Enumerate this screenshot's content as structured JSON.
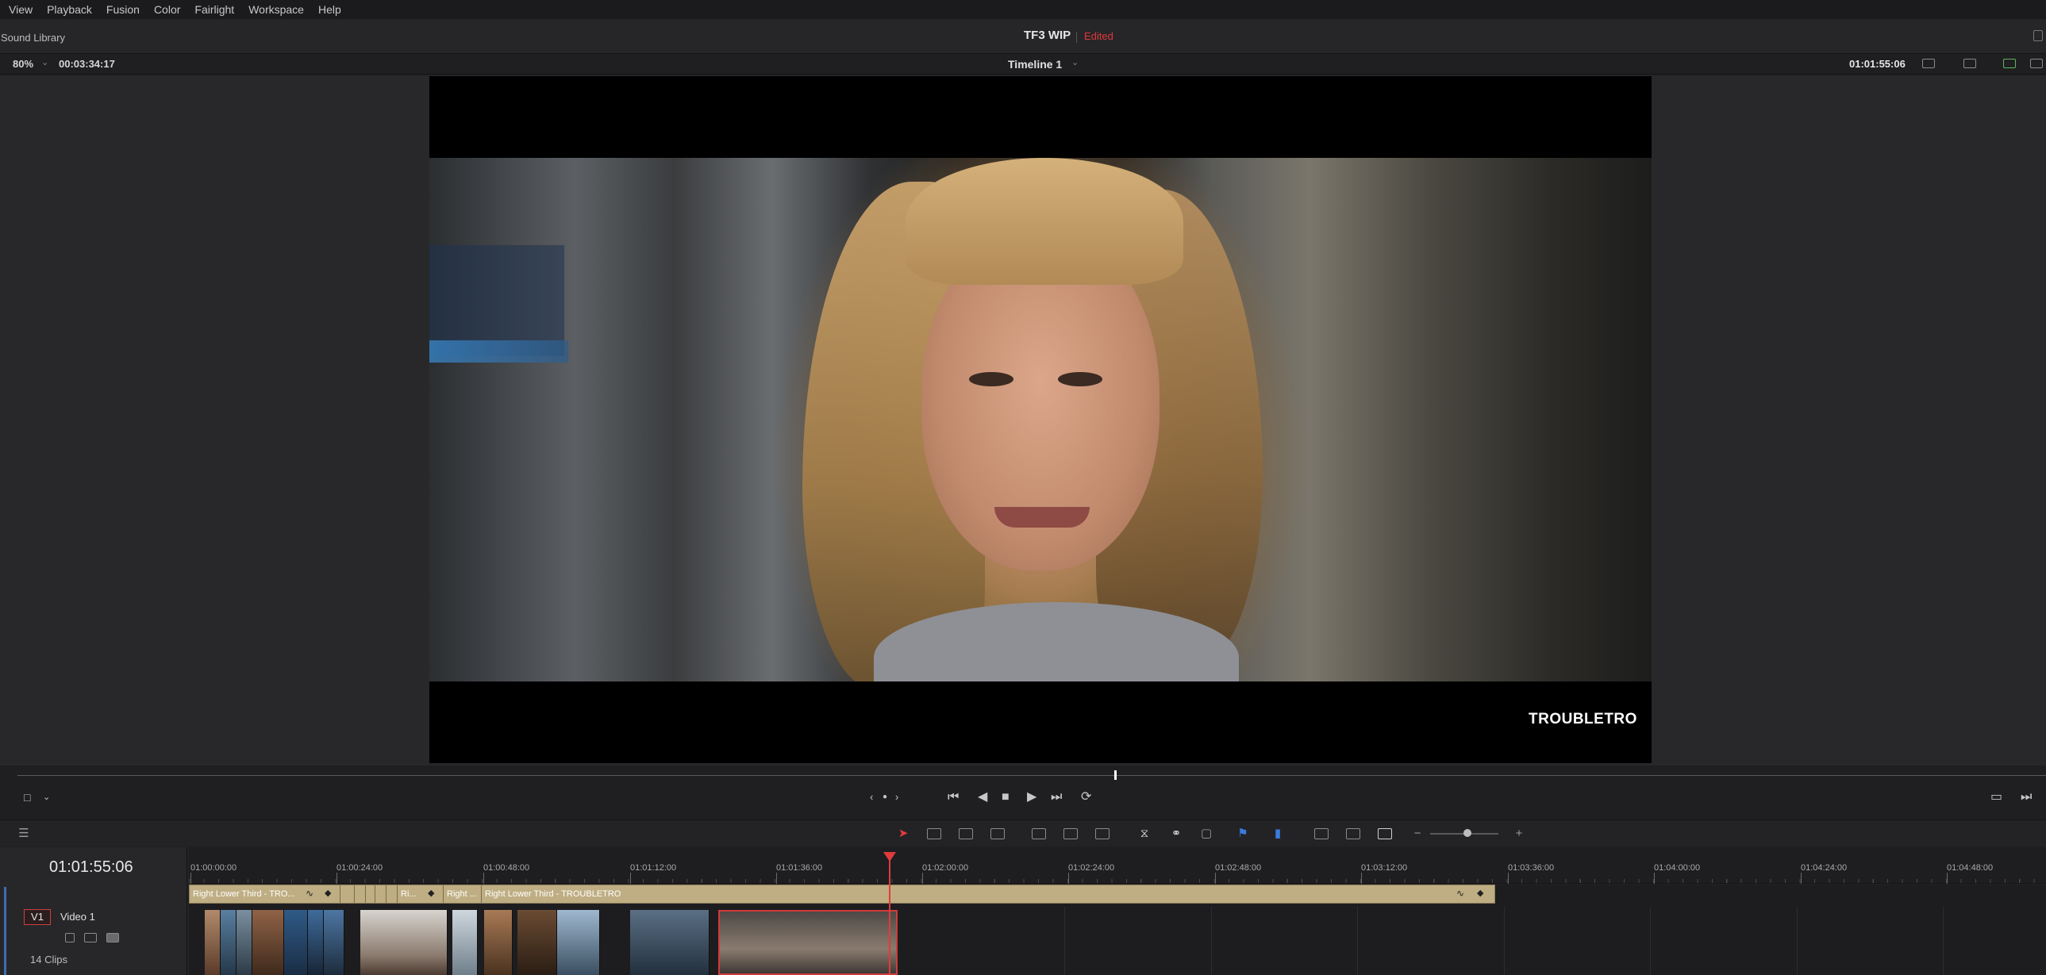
{
  "menu": [
    "View",
    "Playback",
    "Fusion",
    "Color",
    "Fairlight",
    "Workspace",
    "Help"
  ],
  "titlebar": {
    "left_panel": "Sound Library",
    "project": "TF3 WIP",
    "status": "Edited"
  },
  "viewer_header": {
    "zoom": "80%",
    "duration": "00:03:34:17",
    "timeline": "Timeline 1",
    "timecode": "01:01:55:06"
  },
  "viewer": {
    "overlay_text": "TROUBLETRO"
  },
  "timeline": {
    "timecode": "01:01:55:06",
    "track_label": "V1",
    "track_name": "Video 1",
    "clip_count": "14 Clips",
    "ruler": [
      "01:00:00:00",
      "01:00:24:00",
      "01:00:48:00",
      "01:01:12:00",
      "01:01:36:00",
      "01:02:00:00",
      "01:02:24:00",
      "01:02:48:00",
      "01:03:12:00",
      "01:03:36:00",
      "01:04:00:00",
      "01:04:24:00",
      "01:04:48:00"
    ],
    "title_clips": [
      "Right Lower Third - TRO...",
      "Ri...",
      "Right ...",
      "Right Lower Third - TROUBLETRO"
    ]
  },
  "icons": {
    "transport": [
      "skip-to-start-icon",
      "step-back-icon",
      "stop-icon",
      "play-icon",
      "skip-to-end-icon",
      "loop-icon"
    ],
    "toolbar": [
      "selection-pointer-icon",
      "trim-edit-icon",
      "dynamic-trim-icon",
      "blade-icon",
      "insert-clip-icon",
      "overwrite-clip-icon",
      "replace-clip-icon",
      "snapping-icon",
      "linked-selection-icon",
      "position-lock-icon",
      "flag-icon",
      "marker-icon",
      "zoom-full-icon",
      "zoom-detail-icon",
      "zoom-custom-icon",
      "zoom-out-icon",
      "zoom-in-icon"
    ]
  },
  "colors": {
    "accent_red": "#e23b3b",
    "title_clip": "#cfc09a",
    "track_accent": "#3b6fb3"
  }
}
